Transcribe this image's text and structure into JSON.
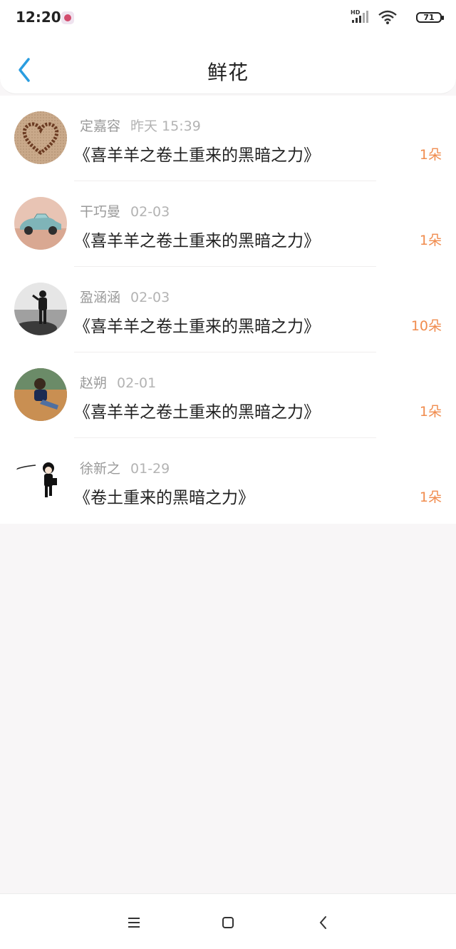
{
  "status_bar": {
    "time": "12:20",
    "battery": "71",
    "network_label": "HD"
  },
  "header": {
    "title": "鲜花",
    "accent_color": "#2a9de0"
  },
  "items": [
    {
      "name": "定嘉容",
      "time": "昨天 15:39",
      "title": "《喜羊羊之卷土重来的黑暗之力》",
      "count": "1朵",
      "avatar": "heart-avatar"
    },
    {
      "name": "干巧曼",
      "time": "02-03",
      "title": "《喜羊羊之卷土重来的黑暗之力》",
      "count": "1朵",
      "avatar": "car-avatar"
    },
    {
      "name": "盈涵涵",
      "time": "02-03",
      "title": "《喜羊羊之卷土重来的黑暗之力》",
      "count": "10朵",
      "avatar": "person-beach-avatar"
    },
    {
      "name": "赵朔",
      "time": "02-01",
      "title": "《喜羊羊之卷土重来的黑暗之力》",
      "count": "1朵",
      "avatar": "person-sofa-avatar"
    },
    {
      "name": "徐新之",
      "time": "01-29",
      "title": "《卷土重来的黑暗之力》",
      "count": "1朵",
      "avatar": "cartoon-avatar"
    }
  ],
  "colors": {
    "count": "#f08c4e",
    "meta": "#9a9a9a"
  }
}
